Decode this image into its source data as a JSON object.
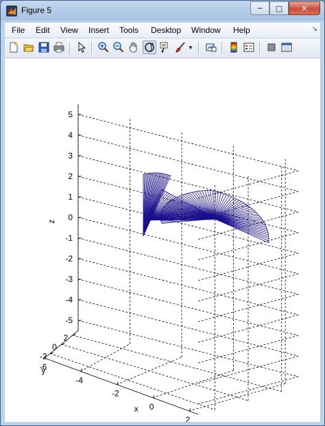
{
  "window": {
    "title": "Figure 5"
  },
  "menu": [
    "File",
    "Edit",
    "View",
    "Insert",
    "Tools",
    "Desktop",
    "Window",
    "Help"
  ],
  "toolbar": [
    "new-figure-icon",
    "open-file-icon",
    "save-icon",
    "print-icon",
    "edit-plot-icon",
    "zoom-in-icon",
    "zoom-out-icon",
    "pan-icon",
    "rotate-3d-icon",
    "data-cursor-icon",
    "brush-icon",
    "brush-dropdown-icon",
    "link-plot-icon",
    "colorbar-icon",
    "legend-icon",
    "hide-plot-tools-icon",
    "show-plot-tools-icon"
  ],
  "axes": {
    "xlabel": "x",
    "ylabel": "y",
    "zlabel": "z",
    "xticks": [
      "-6",
      "-4",
      "-2",
      "0",
      "2"
    ],
    "yticks": [
      "-2",
      "0",
      "2"
    ],
    "zticks": [
      "5",
      "4",
      "3",
      "2",
      "1",
      "0",
      "-1",
      "-2",
      "-3",
      "-4",
      "-5"
    ],
    "grid": true,
    "box": false
  },
  "chart_data": {
    "type": "surface-3d",
    "xlabel": "x",
    "ylabel": "y",
    "zlabel": "z",
    "xlim": [
      -6,
      2.5
    ],
    "ylim": [
      -3,
      3
    ],
    "zlim": [
      -5.5,
      5.5
    ],
    "colors": {
      "mesh": "#1a0f8c",
      "grid": "#000000"
    }
  }
}
